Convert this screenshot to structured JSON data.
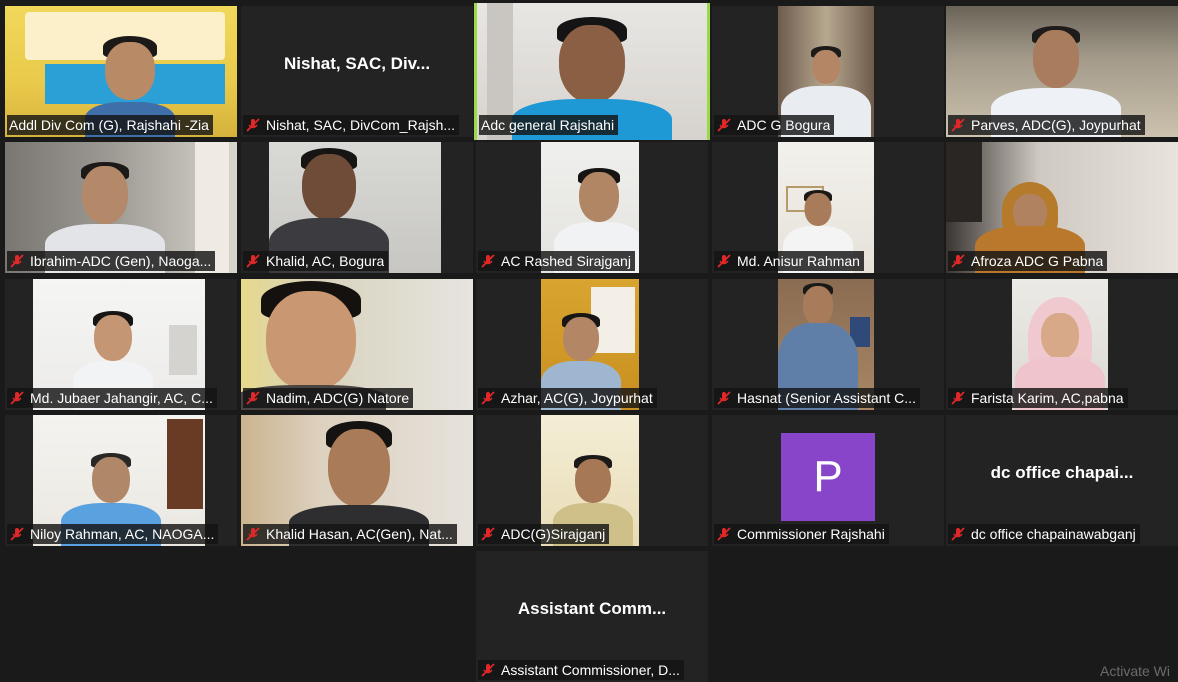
{
  "app": "Zoom Meeting Gallery View",
  "participants": [
    {
      "name": "Addl Div Com (G), Rajshahi -Zia",
      "display": "",
      "muted": true,
      "video": true
    },
    {
      "name": "Nishat, SAC, DivCom_Rajsh...",
      "display": "Nishat, SAC, Div...",
      "muted": true,
      "video": false
    },
    {
      "name": "Adc general Rajshahi",
      "display": "",
      "muted": false,
      "video": true,
      "active": true
    },
    {
      "name": "ADC G Bogura",
      "display": "",
      "muted": true,
      "video": true
    },
    {
      "name": "Parves, ADC(G), Joypurhat",
      "display": "",
      "muted": true,
      "video": true
    },
    {
      "name": "Ibrahim-ADC (Gen), Naoga...",
      "display": "",
      "muted": true,
      "video": true
    },
    {
      "name": "Khalid, AC, Bogura",
      "display": "",
      "muted": true,
      "video": true
    },
    {
      "name": "AC Rashed Sirajganj",
      "display": "",
      "muted": true,
      "video": true
    },
    {
      "name": "Md. Anisur Rahman",
      "display": "",
      "muted": true,
      "video": true
    },
    {
      "name": "Afroza ADC G Pabna",
      "display": "",
      "muted": true,
      "video": true
    },
    {
      "name": "Md. Jubaer Jahangir, AC, C...",
      "display": "",
      "muted": true,
      "video": true
    },
    {
      "name": "Nadim, ADC(G) Natore",
      "display": "",
      "muted": true,
      "video": true
    },
    {
      "name": "Azhar, AC(G), Joypurhat",
      "display": "",
      "muted": true,
      "video": true
    },
    {
      "name": "Hasnat (Senior Assistant C...",
      "display": "",
      "muted": true,
      "video": true
    },
    {
      "name": "Farista Karim, AC,pabna",
      "display": "",
      "muted": true,
      "video": true
    },
    {
      "name": "Niloy Rahman, AC, NAOGA...",
      "display": "",
      "muted": true,
      "video": true
    },
    {
      "name": "Khalid Hasan, AC(Gen), Nat...",
      "display": "",
      "muted": true,
      "video": true
    },
    {
      "name": "ADC(G)Sirajganj",
      "display": "",
      "muted": true,
      "video": true
    },
    {
      "name": "Commissioner Rajshahi",
      "display": "P",
      "muted": true,
      "video": false
    },
    {
      "name": "dc office chapainawabganj",
      "display": "dc office chapai...",
      "muted": true,
      "video": false
    },
    {
      "name": "Assistant Commissioner, D...",
      "display": "Assistant Comm...",
      "muted": true,
      "video": false
    }
  ],
  "colors": {
    "background": "#1a1a1a",
    "tile": "#232323",
    "active_border": "#9bd84a",
    "muted_icon": "#e02828",
    "avatar": "#8845c9"
  },
  "icons": {
    "muted": "mic-muted-icon"
  },
  "watermark": "Activate Wi"
}
